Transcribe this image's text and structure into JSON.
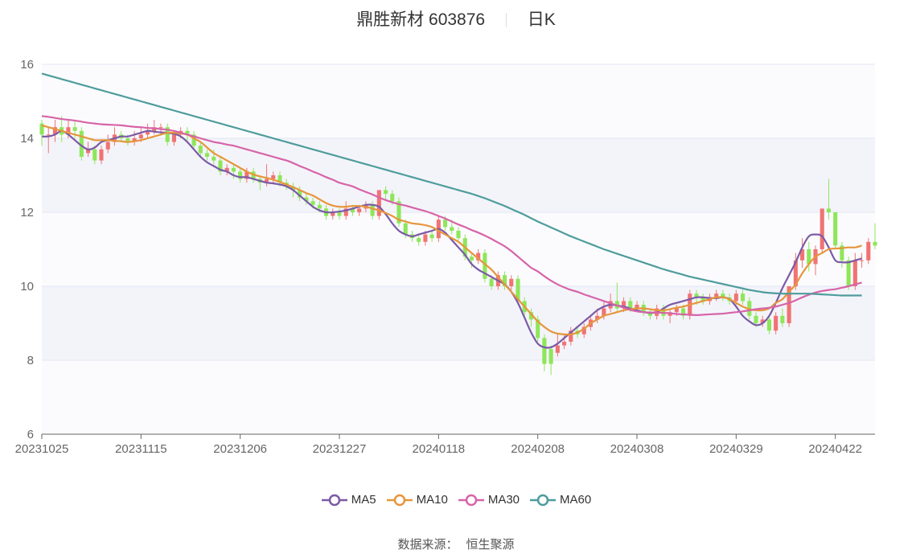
{
  "header": {
    "title": "鼎胜新材 603876",
    "period": "日K"
  },
  "source": {
    "label": "数据来源：",
    "value": "恒生聚源"
  },
  "chart_data": {
    "type": "candlestick",
    "ylim": [
      6,
      16
    ],
    "yticks": [
      6,
      8,
      10,
      12,
      14,
      16
    ],
    "xticks": [
      "20231025",
      "20231115",
      "20231206",
      "20231227",
      "20240118",
      "20240208",
      "20240308",
      "20240329",
      "20240422"
    ],
    "xtick_index": [
      0,
      15,
      30,
      45,
      60,
      75,
      90,
      105,
      120
    ],
    "up_color": "#f07373",
    "down_color": "#8ee65a",
    "candles": [
      [
        14.4,
        14.1,
        14.5,
        13.8
      ],
      [
        14.1,
        14.1,
        14.3,
        13.6
      ],
      [
        14.1,
        14.3,
        14.5,
        13.9
      ],
      [
        14.3,
        14.1,
        14.6,
        13.9
      ],
      [
        14.1,
        14.3,
        14.5,
        14.0
      ],
      [
        14.3,
        14.2,
        14.5,
        14.0
      ],
      [
        14.2,
        13.5,
        14.3,
        13.4
      ],
      [
        13.6,
        13.7,
        13.9,
        13.5
      ],
      [
        13.7,
        13.4,
        13.8,
        13.3
      ],
      [
        13.4,
        13.7,
        13.8,
        13.3
      ],
      [
        13.7,
        13.9,
        14.1,
        13.6
      ],
      [
        13.9,
        14.1,
        14.3,
        13.8
      ],
      [
        14.1,
        14.0,
        14.2,
        13.9
      ],
      [
        14.0,
        13.9,
        14.1,
        13.8
      ],
      [
        13.9,
        14.0,
        14.2,
        13.8
      ],
      [
        14.0,
        14.1,
        14.3,
        13.9
      ],
      [
        14.1,
        14.2,
        14.4,
        14.0
      ],
      [
        14.2,
        14.3,
        14.5,
        14.1
      ],
      [
        14.3,
        14.3,
        14.4,
        14.1
      ],
      [
        14.3,
        13.9,
        14.4,
        13.8
      ],
      [
        13.9,
        14.1,
        14.2,
        13.8
      ],
      [
        14.1,
        14.2,
        14.3,
        14.0
      ],
      [
        14.2,
        14.1,
        14.3,
        13.9
      ],
      [
        14.1,
        13.8,
        14.2,
        13.7
      ],
      [
        13.8,
        13.6,
        13.9,
        13.5
      ],
      [
        13.6,
        13.5,
        13.7,
        13.4
      ],
      [
        13.5,
        13.4,
        13.7,
        13.3
      ],
      [
        13.4,
        13.1,
        13.5,
        13.0
      ],
      [
        13.1,
        13.2,
        13.3,
        13.0
      ],
      [
        13.2,
        13.1,
        13.3,
        12.9
      ],
      [
        13.1,
        12.9,
        13.2,
        12.8
      ],
      [
        12.9,
        13.1,
        13.2,
        12.8
      ],
      [
        13.1,
        12.9,
        13.2,
        12.8
      ],
      [
        12.9,
        12.8,
        13.0,
        12.6
      ],
      [
        12.8,
        12.9,
        13.3,
        12.7
      ],
      [
        12.9,
        13.0,
        13.1,
        12.8
      ],
      [
        13.0,
        12.8,
        13.1,
        12.7
      ],
      [
        12.8,
        12.7,
        12.9,
        12.6
      ],
      [
        12.7,
        12.6,
        12.8,
        12.4
      ],
      [
        12.6,
        12.4,
        12.7,
        12.3
      ],
      [
        12.4,
        12.3,
        12.5,
        12.2
      ],
      [
        12.3,
        12.2,
        12.4,
        12.1
      ],
      [
        12.2,
        12.1,
        12.3,
        12.0
      ],
      [
        12.1,
        11.9,
        12.2,
        11.8
      ],
      [
        11.9,
        12.0,
        12.1,
        11.8
      ],
      [
        12.0,
        11.9,
        12.1,
        11.8
      ],
      [
        11.9,
        12.1,
        12.3,
        11.8
      ],
      [
        12.1,
        12.0,
        12.2,
        11.9
      ],
      [
        12.0,
        12.1,
        12.2,
        11.9
      ],
      [
        12.1,
        12.2,
        12.3,
        12.0
      ],
      [
        12.2,
        11.9,
        12.3,
        11.8
      ],
      [
        11.9,
        12.6,
        12.6,
        11.8
      ],
      [
        12.6,
        12.5,
        12.7,
        12.3
      ],
      [
        12.5,
        12.3,
        12.6,
        12.2
      ],
      [
        12.3,
        11.7,
        12.4,
        11.6
      ],
      [
        11.7,
        11.4,
        11.8,
        11.3
      ],
      [
        11.4,
        11.3,
        11.5,
        11.2
      ],
      [
        11.3,
        11.2,
        11.4,
        11.1
      ],
      [
        11.2,
        11.4,
        11.5,
        11.1
      ],
      [
        11.4,
        11.3,
        11.5,
        11.2
      ],
      [
        11.3,
        11.8,
        11.9,
        11.2
      ],
      [
        11.8,
        11.6,
        11.9,
        11.5
      ],
      [
        11.6,
        11.5,
        11.8,
        11.4
      ],
      [
        11.5,
        11.3,
        11.6,
        11.2
      ],
      [
        11.3,
        10.8,
        11.4,
        10.7
      ],
      [
        10.8,
        10.7,
        10.9,
        10.5
      ],
      [
        10.7,
        10.9,
        11.0,
        10.6
      ],
      [
        10.9,
        10.2,
        11.0,
        10.1
      ],
      [
        10.2,
        10.0,
        10.3,
        9.9
      ],
      [
        10.0,
        10.3,
        10.4,
        9.9
      ],
      [
        10.3,
        10.0,
        10.4,
        9.9
      ],
      [
        10.0,
        10.2,
        10.3,
        9.9
      ],
      [
        10.2,
        9.6,
        10.3,
        9.5
      ],
      [
        9.6,
        9.3,
        9.7,
        9.2
      ],
      [
        9.3,
        9.1,
        9.4,
        8.9
      ],
      [
        9.1,
        8.6,
        9.2,
        8.5
      ],
      [
        8.6,
        7.9,
        8.7,
        7.7
      ],
      [
        8.3,
        7.9,
        8.4,
        7.6
      ],
      [
        8.2,
        8.4,
        8.7,
        8.1
      ],
      [
        8.4,
        8.5,
        8.7,
        8.3
      ],
      [
        8.5,
        8.8,
        8.9,
        8.4
      ],
      [
        8.8,
        8.7,
        8.9,
        8.6
      ],
      [
        8.7,
        8.9,
        9.0,
        8.6
      ],
      [
        8.9,
        9.1,
        9.2,
        8.8
      ],
      [
        9.1,
        9.2,
        9.4,
        9.0
      ],
      [
        9.2,
        9.4,
        9.6,
        9.1
      ],
      [
        9.4,
        9.6,
        9.8,
        9.3
      ],
      [
        9.6,
        9.4,
        10.1,
        9.3
      ],
      [
        9.4,
        9.6,
        9.7,
        9.3
      ],
      [
        9.6,
        9.4,
        9.7,
        9.3
      ],
      [
        9.4,
        9.5,
        9.6,
        9.3
      ],
      [
        9.5,
        9.3,
        9.6,
        9.2
      ],
      [
        9.3,
        9.2,
        9.4,
        9.1
      ],
      [
        9.2,
        9.4,
        9.5,
        9.1
      ],
      [
        9.4,
        9.2,
        9.5,
        9.1
      ],
      [
        9.2,
        9.3,
        9.4,
        9.0
      ],
      [
        9.3,
        9.4,
        9.5,
        9.2
      ],
      [
        9.4,
        9.2,
        9.5,
        9.1
      ],
      [
        9.2,
        9.8,
        9.9,
        9.1
      ],
      [
        9.8,
        9.7,
        9.9,
        9.5
      ],
      [
        9.7,
        9.6,
        9.8,
        9.5
      ],
      [
        9.6,
        9.7,
        9.8,
        9.5
      ],
      [
        9.7,
        9.8,
        9.9,
        9.6
      ],
      [
        9.8,
        9.7,
        9.9,
        9.6
      ],
      [
        9.7,
        9.6,
        9.8,
        9.5
      ],
      [
        9.6,
        9.8,
        9.9,
        9.5
      ],
      [
        9.8,
        9.6,
        9.9,
        9.5
      ],
      [
        9.6,
        9.2,
        9.7,
        9.1
      ],
      [
        9.2,
        9.0,
        9.3,
        8.9
      ],
      [
        9.0,
        9.1,
        9.2,
        8.9
      ],
      [
        9.1,
        8.8,
        9.2,
        8.7
      ],
      [
        8.8,
        9.2,
        9.3,
        8.7
      ],
      [
        9.2,
        9.0,
        9.4,
        8.9
      ],
      [
        9.0,
        10.0,
        10.0,
        8.9
      ],
      [
        10.0,
        10.7,
        10.9,
        9.9
      ],
      [
        10.7,
        11.0,
        11.3,
        10.5
      ],
      [
        11.0,
        10.6,
        11.2,
        10.4
      ],
      [
        10.6,
        11.0,
        11.1,
        10.3
      ],
      [
        11.0,
        12.1,
        12.1,
        10.9
      ],
      [
        12.1,
        12.0,
        12.9,
        11.8
      ],
      [
        12.0,
        11.1,
        12.0,
        11.0
      ],
      [
        11.1,
        10.7,
        11.2,
        10.5
      ],
      [
        10.7,
        10.0,
        10.8,
        9.9
      ],
      [
        10.0,
        10.7,
        10.9,
        9.9
      ],
      [
        10.7,
        10.7,
        10.9,
        10.5
      ],
      [
        10.7,
        11.2,
        11.3,
        10.6
      ],
      [
        11.2,
        11.1,
        11.7,
        11.0
      ]
    ],
    "series": [
      {
        "name": "MA5",
        "color": "#7b5aa6",
        "values": [
          14.05,
          14.05,
          14.1,
          14.2,
          14.1,
          13.95,
          13.8,
          13.7,
          13.75,
          13.9,
          13.95,
          14.0,
          14.05,
          14.05,
          14.1,
          14.15,
          14.2,
          14.18,
          14.16,
          14.15,
          14.12,
          14.05,
          13.9,
          13.7,
          13.5,
          13.35,
          13.25,
          13.15,
          13.1,
          13.0,
          12.95,
          12.95,
          12.9,
          12.85,
          12.8,
          12.78,
          12.75,
          12.7,
          12.6,
          12.45,
          12.3,
          12.15,
          12.05,
          12.0,
          12.0,
          12.02,
          12.05,
          12.1,
          12.15,
          12.2,
          12.2,
          12.15,
          11.95,
          11.7,
          11.5,
          11.4,
          11.35,
          11.4,
          11.45,
          11.5,
          11.55,
          11.45,
          11.25,
          11.05,
          10.85,
          10.6,
          10.45,
          10.35,
          10.25,
          10.15,
          10.05,
          9.85,
          9.55,
          9.15,
          8.75,
          8.45,
          8.35,
          8.35,
          8.45,
          8.6,
          8.75,
          8.9,
          9.05,
          9.2,
          9.35,
          9.45,
          9.5,
          9.48,
          9.45,
          9.4,
          9.35,
          9.3,
          9.28,
          9.3,
          9.4,
          9.5,
          9.55,
          9.6,
          9.65,
          9.7,
          9.7,
          9.68,
          9.68,
          9.7,
          9.65,
          9.45,
          9.2,
          9.05,
          8.95,
          9.0,
          9.2,
          9.55,
          9.95,
          10.3,
          10.65,
          11.05,
          11.35,
          11.4,
          11.35,
          11.05,
          10.7,
          10.65,
          10.65,
          10.7,
          10.75
        ]
      },
      {
        "name": "MA10",
        "color": "#e6963c",
        "values": [
          14.35,
          14.3,
          14.25,
          14.2,
          14.15,
          14.1,
          14.05,
          14.0,
          13.95,
          13.95,
          13.95,
          13.93,
          13.92,
          13.9,
          13.92,
          13.95,
          14.0,
          14.05,
          14.1,
          14.15,
          14.15,
          14.13,
          14.1,
          14.0,
          13.9,
          13.75,
          13.6,
          13.5,
          13.4,
          13.3,
          13.2,
          13.1,
          13.02,
          12.97,
          12.93,
          12.88,
          12.82,
          12.75,
          12.68,
          12.6,
          12.52,
          12.45,
          12.35,
          12.25,
          12.18,
          12.15,
          12.15,
          12.17,
          12.17,
          12.15,
          12.1,
          12.05,
          11.98,
          11.9,
          11.8,
          11.75,
          11.7,
          11.68,
          11.65,
          11.6,
          11.5,
          11.4,
          11.3,
          11.2,
          11.05,
          10.9,
          10.75,
          10.6,
          10.45,
          10.25,
          10.05,
          9.85,
          9.65,
          9.45,
          9.25,
          9.05,
          8.9,
          8.78,
          8.72,
          8.7,
          8.7,
          8.75,
          8.85,
          9.0,
          9.1,
          9.2,
          9.25,
          9.3,
          9.35,
          9.38,
          9.4,
          9.4,
          9.38,
          9.35,
          9.35,
          9.38,
          9.42,
          9.45,
          9.5,
          9.55,
          9.6,
          9.65,
          9.7,
          9.7,
          9.65,
          9.55,
          9.45,
          9.38,
          9.35,
          9.35,
          9.4,
          9.55,
          9.65,
          9.85,
          10.05,
          10.35,
          10.6,
          10.8,
          10.9,
          11.0,
          11.02,
          11.03,
          11.05,
          11.05,
          11.1
        ]
      },
      {
        "name": "MA30",
        "color": "#d764a8",
        "values": [
          14.6,
          14.58,
          14.55,
          14.52,
          14.5,
          14.48,
          14.45,
          14.42,
          14.4,
          14.38,
          14.37,
          14.36,
          14.35,
          14.33,
          14.31,
          14.3,
          14.28,
          14.27,
          14.25,
          14.23,
          14.2,
          14.15,
          14.1,
          14.05,
          14.0,
          13.95,
          13.9,
          13.87,
          13.83,
          13.8,
          13.75,
          13.7,
          13.65,
          13.6,
          13.55,
          13.5,
          13.45,
          13.4,
          13.33,
          13.25,
          13.18,
          13.1,
          13.03,
          12.95,
          12.88,
          12.8,
          12.75,
          12.7,
          12.62,
          12.55,
          12.48,
          12.4,
          12.33,
          12.27,
          12.22,
          12.18,
          12.13,
          12.08,
          12.03,
          11.97,
          11.9,
          11.83,
          11.75,
          11.67,
          11.6,
          11.52,
          11.45,
          11.37,
          11.28,
          11.18,
          11.08,
          10.95,
          10.8,
          10.65,
          10.5,
          10.4,
          10.27,
          10.15,
          10.05,
          9.97,
          9.9,
          9.85,
          9.78,
          9.72,
          9.66,
          9.6,
          9.54,
          9.48,
          9.42,
          9.36,
          9.32,
          9.3,
          9.29,
          9.29,
          9.28,
          9.27,
          9.25,
          9.24,
          9.23,
          9.22,
          9.23,
          9.24,
          9.25,
          9.26,
          9.28,
          9.3,
          9.32,
          9.35,
          9.38,
          9.4,
          9.42,
          9.45,
          9.5,
          9.55,
          9.62,
          9.7,
          9.77,
          9.83,
          9.87,
          9.9,
          9.92,
          9.96,
          10.0,
          10.05,
          10.1
        ]
      },
      {
        "name": "MA60",
        "color": "#4e9c9c",
        "values": [
          15.75,
          15.7,
          15.65,
          15.6,
          15.55,
          15.5,
          15.45,
          15.4,
          15.35,
          15.3,
          15.25,
          15.2,
          15.15,
          15.1,
          15.05,
          15.0,
          14.95,
          14.9,
          14.85,
          14.8,
          14.75,
          14.7,
          14.65,
          14.6,
          14.55,
          14.5,
          14.45,
          14.4,
          14.35,
          14.3,
          14.25,
          14.2,
          14.15,
          14.1,
          14.05,
          14.0,
          13.95,
          13.9,
          13.85,
          13.8,
          13.75,
          13.7,
          13.65,
          13.6,
          13.55,
          13.5,
          13.45,
          13.4,
          13.35,
          13.3,
          13.25,
          13.2,
          13.15,
          13.1,
          13.05,
          13.0,
          12.95,
          12.9,
          12.85,
          12.8,
          12.75,
          12.7,
          12.65,
          12.6,
          12.55,
          12.5,
          12.44,
          12.38,
          12.31,
          12.24,
          12.17,
          12.09,
          12.01,
          11.93,
          11.84,
          11.75,
          11.67,
          11.59,
          11.51,
          11.43,
          11.35,
          11.28,
          11.21,
          11.14,
          11.07,
          11.0,
          10.94,
          10.88,
          10.82,
          10.76,
          10.7,
          10.64,
          10.58,
          10.52,
          10.46,
          10.41,
          10.36,
          10.31,
          10.26,
          10.22,
          10.18,
          10.14,
          10.1,
          10.06,
          10.02,
          9.98,
          9.94,
          9.9,
          9.87,
          9.84,
          9.82,
          9.81,
          9.8,
          9.8,
          9.8,
          9.8,
          9.8,
          9.79,
          9.78,
          9.77,
          9.76,
          9.75,
          9.75,
          9.75,
          9.75
        ]
      }
    ]
  }
}
